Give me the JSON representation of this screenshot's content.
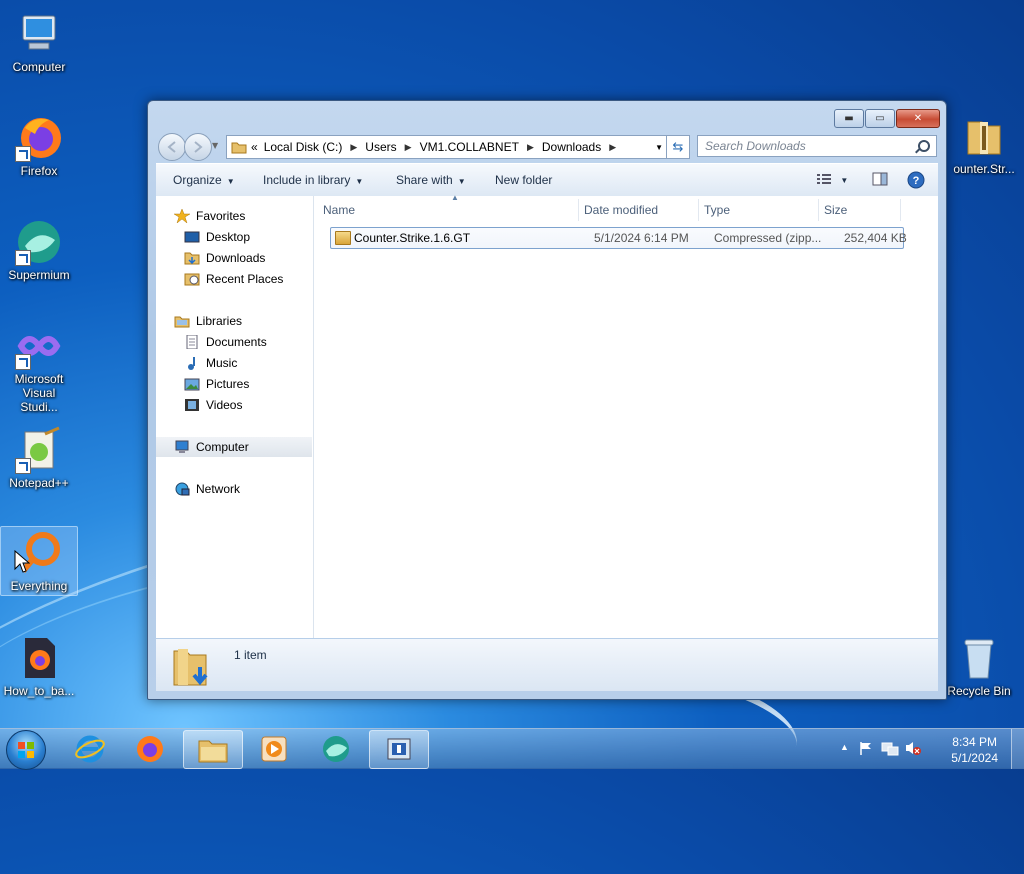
{
  "desktop": {
    "icons": [
      {
        "label": "Computer"
      },
      {
        "label": "Firefox"
      },
      {
        "label": "Supermium"
      },
      {
        "label": "Microsoft Visual Studi..."
      },
      {
        "label": "Notepad++"
      },
      {
        "label": "Everything"
      },
      {
        "label": "How_to_ba..."
      },
      {
        "label": "ounter.Str..."
      },
      {
        "label": "Recycle Bin"
      }
    ]
  },
  "explorer": {
    "address": {
      "overflow": "«",
      "crumbs": [
        "Local Disk (C:)",
        "Users",
        "VM1.COLLABNET",
        "Downloads"
      ]
    },
    "search_placeholder": "Search Downloads",
    "toolbar": {
      "organize": "Organize",
      "include_in_library": "Include in library",
      "share_with": "Share with",
      "new_folder": "New folder"
    },
    "nav": {
      "favorites": "Favorites",
      "desktop": "Desktop",
      "downloads": "Downloads",
      "recent_places": "Recent Places",
      "libraries": "Libraries",
      "documents": "Documents",
      "music": "Music",
      "pictures": "Pictures",
      "videos": "Videos",
      "computer": "Computer",
      "network": "Network"
    },
    "columns": {
      "name": "Name",
      "date_modified": "Date modified",
      "type": "Type",
      "size": "Size"
    },
    "files": [
      {
        "name": "Counter.Strike.1.6.GT",
        "date_modified": "5/1/2024 6:14 PM",
        "type": "Compressed (zipp...",
        "size": "252,404 KB"
      }
    ],
    "status": "1 item"
  },
  "taskbar": {
    "time": "8:34 PM",
    "date": "5/1/2024"
  }
}
